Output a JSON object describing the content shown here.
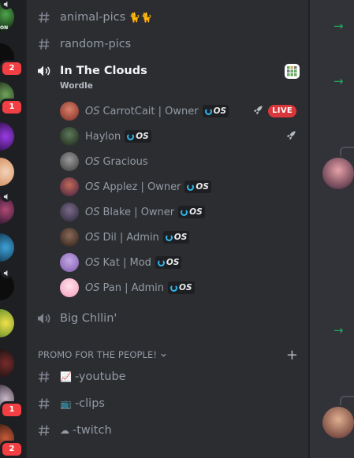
{
  "rail": {
    "servers": [
      {
        "name": "server-voice-top",
        "badge": "",
        "voice": true,
        "label": "ON"
      },
      {
        "name": "server-2",
        "badge": "2",
        "voice": false
      },
      {
        "name": "server-3",
        "badge": "1",
        "voice": false
      },
      {
        "name": "server-purple",
        "badge": "",
        "voice": false
      },
      {
        "name": "server-anime",
        "badge": "",
        "voice": true
      },
      {
        "name": "server-blue",
        "badge": "",
        "voice": false
      },
      {
        "name": "server-wu",
        "badge": "",
        "voice": true
      },
      {
        "name": "server-lemon",
        "badge": "",
        "voice": false
      },
      {
        "name": "server-dark",
        "badge": "",
        "voice": false
      },
      {
        "name": "server-girl",
        "badge": "1",
        "voice": false
      },
      {
        "name": "server-bottom",
        "badge": "2",
        "voice": false
      }
    ]
  },
  "channels": {
    "animal_pics": {
      "label": "animal-pics",
      "emoji": "🐈🐈"
    },
    "random_pics": {
      "label": "random-pics"
    },
    "voice_active": {
      "label": "In The Clouds",
      "activity": "Wordle",
      "members": [
        {
          "prefix": "OS",
          "name": "CarrotCait | Owner",
          "tag": "OS",
          "rocket": true,
          "live": "LIVE"
        },
        {
          "prefix": "",
          "name": "Haylon",
          "tag": "OS",
          "rocket": true,
          "live": ""
        },
        {
          "prefix": "OS",
          "name": "Gracious",
          "tag": "",
          "rocket": false,
          "live": ""
        },
        {
          "prefix": "OS",
          "name": "Applez | Owner",
          "tag": "OS",
          "rocket": false,
          "live": ""
        },
        {
          "prefix": "OS",
          "name": "Blake | Owner",
          "tag": "OS",
          "rocket": false,
          "live": ""
        },
        {
          "prefix": "OS",
          "name": "Dil | Admin",
          "tag": "OS",
          "rocket": false,
          "live": ""
        },
        {
          "prefix": "OS",
          "name": "Kat | Mod",
          "tag": "OS",
          "rocket": false,
          "live": ""
        },
        {
          "prefix": "OS",
          "name": "Pan | Admin",
          "tag": "OS",
          "rocket": false,
          "live": ""
        }
      ]
    },
    "voice_idle": {
      "label": "Big Chllin'"
    },
    "category": {
      "label": "PROMO FOR THE PEOPLE!"
    },
    "promo": [
      {
        "emoji": "📈",
        "label": "-youtube"
      },
      {
        "emoji": "📺",
        "label": "-clips"
      },
      {
        "emoji": "☁",
        "label": "-twitch"
      }
    ]
  },
  "colors": {
    "live": "#da373c",
    "badge": "#f23f43",
    "accent_green": "#23a55a",
    "tag_ring": "#2eb6ea"
  }
}
